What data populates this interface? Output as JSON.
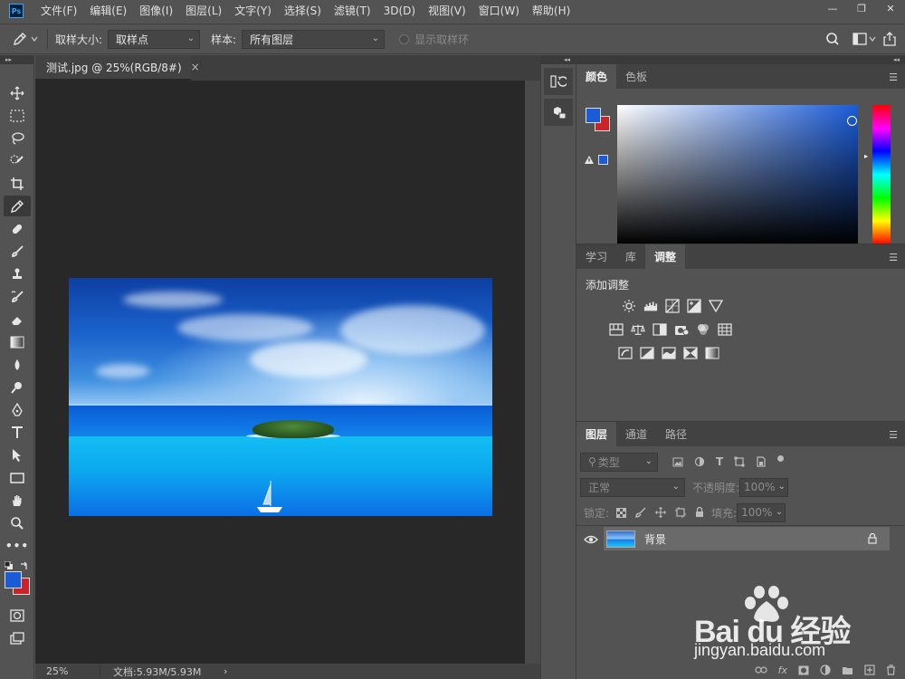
{
  "menubar": {
    "logo": "Ps",
    "items": [
      "文件(F)",
      "编辑(E)",
      "图像(I)",
      "图层(L)",
      "文字(Y)",
      "选择(S)",
      "滤镜(T)",
      "3D(D)",
      "视图(V)",
      "窗口(W)",
      "帮助(H)"
    ],
    "window_controls": [
      "—",
      "❐",
      "✕"
    ]
  },
  "options": {
    "sample_size_label": "取样大小:",
    "sample_size_value": "取样点",
    "sample_label": "样本:",
    "sample_value": "所有图层",
    "show_ring_label": "显示取样环"
  },
  "document": {
    "tab_title": "测试.jpg @ 25%(RGB/8#)",
    "close": "×",
    "zoom": "25%",
    "doc_info": "文档:5.93M/5.93M",
    "more": "›"
  },
  "tools": [
    "move",
    "marquee",
    "lasso",
    "quick-select",
    "crop",
    "eyedropper",
    "healing",
    "brush",
    "stamp",
    "history-brush",
    "eraser",
    "gradient",
    "blur",
    "dodge",
    "pen",
    "type",
    "path-select",
    "rectangle",
    "hand",
    "zoom",
    "more"
  ],
  "active_tool": "eyedropper",
  "color_panel": {
    "tabs": [
      "颜色",
      "色板"
    ],
    "active_tab": 0,
    "foreground": "#1a5bd8",
    "background": "#c8242a"
  },
  "adjust_panel": {
    "tabs": [
      "学习",
      "库",
      "调整"
    ],
    "active_tab": 2,
    "title": "添加调整"
  },
  "layers_panel": {
    "tabs": [
      "图层",
      "通道",
      "路径"
    ],
    "active_tab": 0,
    "filter_placeholder": "类型",
    "blend_mode": "正常",
    "opacity_label": "不透明度:",
    "opacity_value": "100%",
    "lock_label": "锁定:",
    "fill_label": "填充:",
    "fill_value": "100%",
    "layers": [
      {
        "name": "背景",
        "visible": true,
        "locked": true
      }
    ]
  },
  "watermark": {
    "brand": "Bai du 经验",
    "url": "jingyan.baidu.com"
  }
}
